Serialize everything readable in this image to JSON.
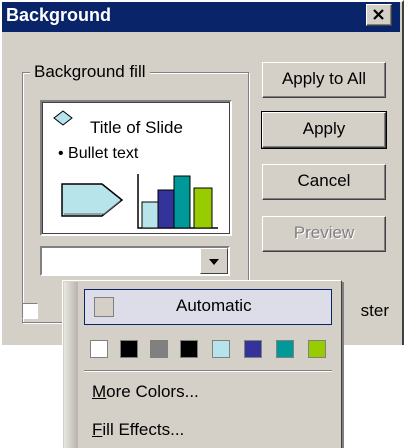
{
  "dialog": {
    "title": "Background",
    "group_label": "Background fill",
    "preview": {
      "title_text": "Title of Slide",
      "bullet_text": "Bullet text"
    },
    "combo_value": ""
  },
  "buttons": {
    "apply_all": "Apply to All",
    "apply": "Apply",
    "cancel": "Cancel",
    "preview": "Preview"
  },
  "checkbox_label_visible": "ster",
  "color_menu": {
    "automatic_label": "Automatic",
    "more_colors": {
      "first": "M",
      "rest": "ore Colors..."
    },
    "fill_effects": {
      "first": "F",
      "rest": "ill Effects..."
    },
    "swatches": [
      "#ffffff",
      "#000000",
      "#808080",
      "#000000",
      "#b7e3ea",
      "#333399",
      "#009999",
      "#99cc00"
    ]
  },
  "colors": {
    "title_bar": "#0a246a",
    "dialog_face": "#d4d0c8"
  }
}
